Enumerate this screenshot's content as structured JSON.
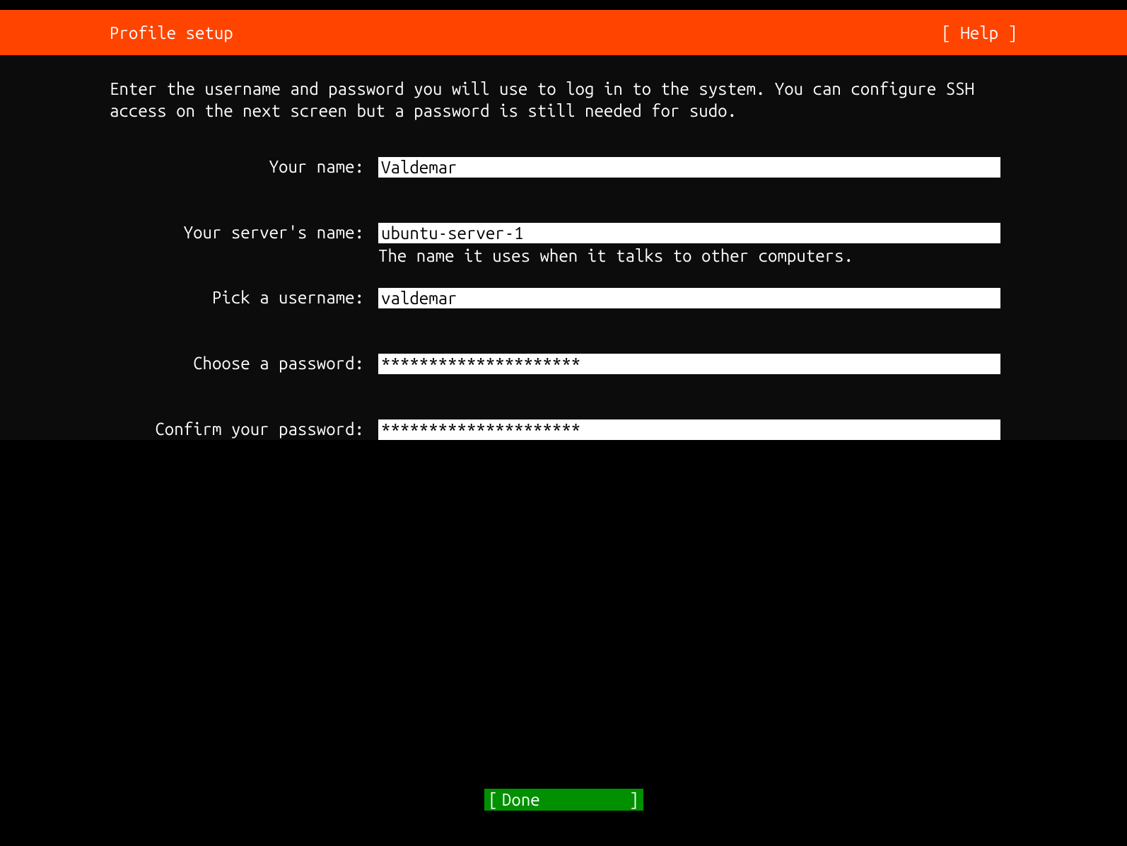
{
  "header": {
    "title": "Profile setup",
    "help_label": "[ Help ]"
  },
  "description": "Enter the username and password you will use to log in to the system. You can configure SSH access on the next screen but a password is still needed for sudo.",
  "fields": {
    "name": {
      "label": "Your name:",
      "value": "Valdemar"
    },
    "server_name": {
      "label": "Your server's name:",
      "value": "ubuntu-server-1",
      "hint": "The name it uses when it talks to other computers."
    },
    "username": {
      "label": "Pick a username:",
      "value": "valdemar"
    },
    "password": {
      "label": "Choose a password:",
      "value": "*********************"
    },
    "confirm_password": {
      "label": "Confirm your password:",
      "value": "*********************"
    }
  },
  "footer": {
    "done_label": "Done",
    "done_prefix": "[",
    "done_suffix": "]"
  }
}
